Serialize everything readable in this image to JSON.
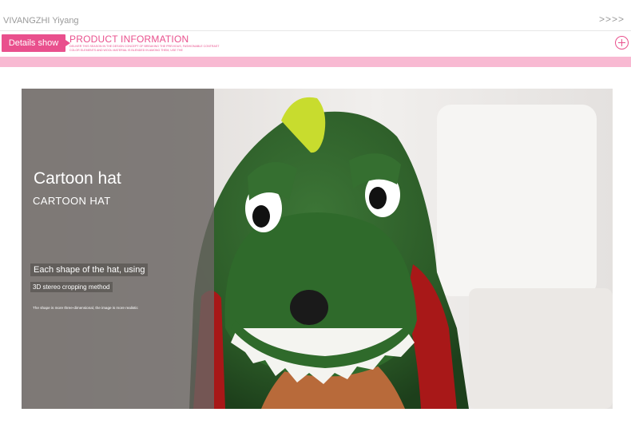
{
  "header": {
    "brand": "VIVANGZHI Yiyang",
    "arrows": ">>>>"
  },
  "info_bar": {
    "details_button": "Details show",
    "title": "PRODUCT INFORMATION",
    "subtitle": "DELIVER THIS SEASON IN THE DESIGN CONCEPT OF BREAKING THE PREVIOUS, FASHIONABLE CONTRAST COLOR ELEMENTS AND WOOL MATERIAL IS BLENDED IN AMONG THEM, USE THE",
    "accent_color": "#e9508d",
    "bar_color": "#f8b9d2",
    "expand_icon": "plus-circle-icon"
  },
  "feature": {
    "title": "Cartoon hat",
    "subtitle": "CARTOON HAT",
    "line1": "Each shape of the hat, using",
    "line2": "3D stereo cropping method",
    "line3": "The shape is more three-dimensional, the image is more realistic"
  },
  "photo": {
    "subject": "green dinosaur hooded costume",
    "main_color": "#2f5e2a",
    "lining_color": "#a81818",
    "horn_color": "#c8dc2e"
  }
}
